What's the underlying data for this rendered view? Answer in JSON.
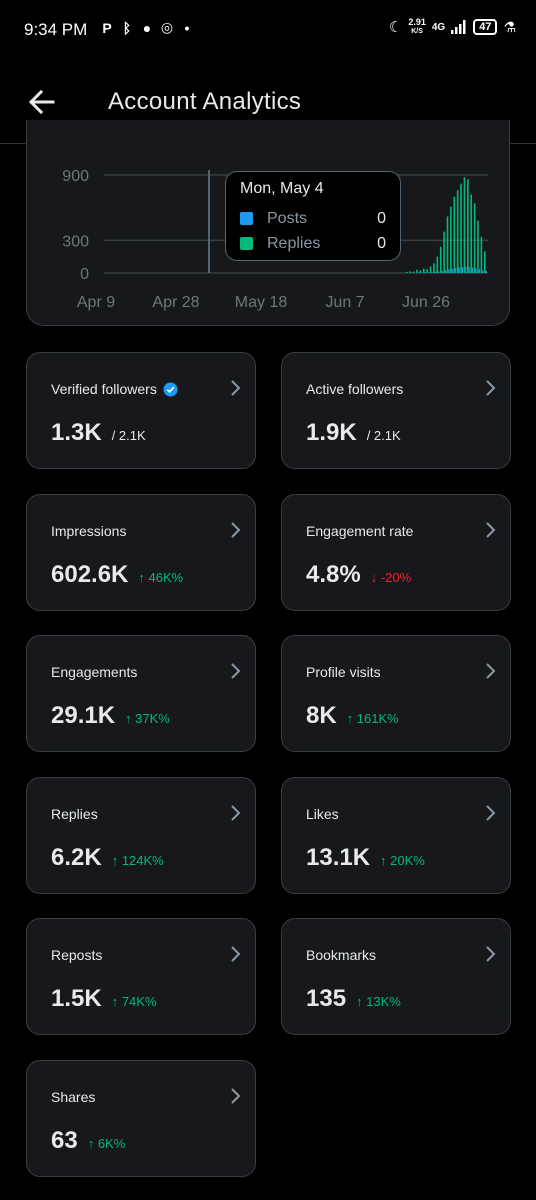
{
  "status_bar": {
    "time": "9:34 PM",
    "speed_top": "2.91",
    "speed_bottom": "K/S",
    "network": "4G",
    "battery": "47"
  },
  "header": {
    "title": "Account Analytics",
    "back_icon": "arrow-left-icon"
  },
  "chart_data": {
    "type": "bar",
    "y_ticks": [
      "900",
      "300",
      "0"
    ],
    "x_labels": [
      "Apr 9",
      "Apr 28",
      "May 18",
      "Jun 7",
      "Jun 26"
    ],
    "series": [
      {
        "name": "Posts",
        "color": "#1d9bf0"
      },
      {
        "name": "Replies",
        "color": "#00ba7c"
      }
    ],
    "replies": [
      10,
      15,
      12,
      30,
      25,
      40,
      35,
      60,
      90,
      150,
      240,
      380,
      520,
      610,
      700,
      760,
      820,
      880,
      860,
      720,
      640,
      480,
      330,
      200
    ],
    "posts": [
      0,
      2,
      0,
      5,
      3,
      6,
      4,
      8,
      10,
      14,
      20,
      28,
      35,
      40,
      45,
      50,
      55,
      58,
      56,
      50,
      44,
      36,
      26,
      18
    ],
    "ylim": [
      0,
      1000
    ],
    "tooltip": {
      "date": "Mon, May 4",
      "rows": [
        {
          "label": "Posts",
          "value": "0",
          "color": "#1d9bf0"
        },
        {
          "label": "Replies",
          "value": "0",
          "color": "#00ba7c"
        }
      ]
    }
  },
  "metrics": [
    {
      "label": "Verified followers",
      "value": "1.3K",
      "sub": "/ 2.1K",
      "change": "",
      "dir": ""
    },
    {
      "label": "Active followers",
      "value": "1.9K",
      "sub": "/ 2.1K",
      "change": "",
      "dir": ""
    },
    {
      "label": "Impressions",
      "value": "602.6K",
      "sub": "",
      "change": "↑ 46K%",
      "dir": "up"
    },
    {
      "label": "Engagement rate",
      "value": "4.8%",
      "sub": "",
      "change": "↓ -20%",
      "dir": "down"
    },
    {
      "label": "Engagements",
      "value": "29.1K",
      "sub": "",
      "change": "↑ 37K%",
      "dir": "up"
    },
    {
      "label": "Profile visits",
      "value": "8K",
      "sub": "",
      "change": "↑ 161K%",
      "dir": "up"
    },
    {
      "label": "Replies",
      "value": "6.2K",
      "sub": "",
      "change": "↑ 124K%",
      "dir": "up"
    },
    {
      "label": "Likes",
      "value": "13.1K",
      "sub": "",
      "change": "↑ 20K%",
      "dir": "up"
    },
    {
      "label": "Reposts",
      "value": "1.5K",
      "sub": "",
      "change": "↑ 74K%",
      "dir": "up"
    },
    {
      "label": "Bookmarks",
      "value": "135",
      "sub": "",
      "change": "↑ 13K%",
      "dir": "up"
    },
    {
      "label": "Shares",
      "value": "63",
      "sub": "",
      "change": "↑ 6K%",
      "dir": "up"
    }
  ]
}
